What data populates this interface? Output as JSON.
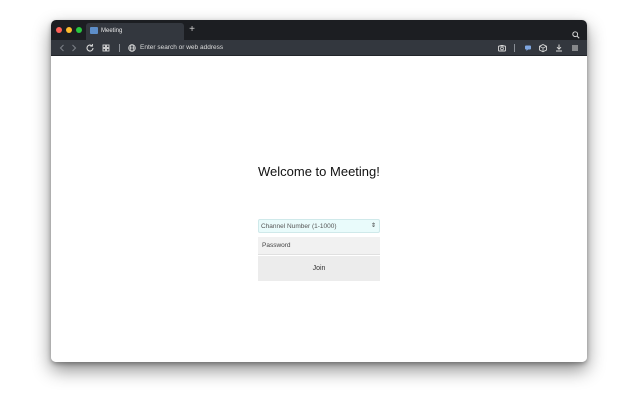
{
  "browser": {
    "tab": {
      "title": "Meeting",
      "favicon": "meeting-favicon-icon"
    },
    "new_tab_label": "+",
    "address_bar": {
      "placeholder": "Enter search or web address"
    },
    "icons": {
      "back": "chevron-left-icon",
      "forward": "chevron-right-icon",
      "reload": "reload-icon",
      "speed_dial": "grid-icon",
      "site_info": "globe-icon",
      "snapshot": "camera-icon",
      "chat": "chat-icon",
      "extensions": "cube-icon",
      "downloads": "download-icon",
      "menu": "menu-icon",
      "search": "search-icon"
    },
    "traffic_light_colors": [
      "#fd5f57",
      "#febc2e",
      "#28c840"
    ]
  },
  "page": {
    "heading": "Welcome to Meeting!",
    "channel_select": {
      "selected": "Channel Number (1-1000)",
      "arrow": "⇕"
    },
    "password": {
      "placeholder": "Password"
    },
    "join_label": "Join"
  }
}
